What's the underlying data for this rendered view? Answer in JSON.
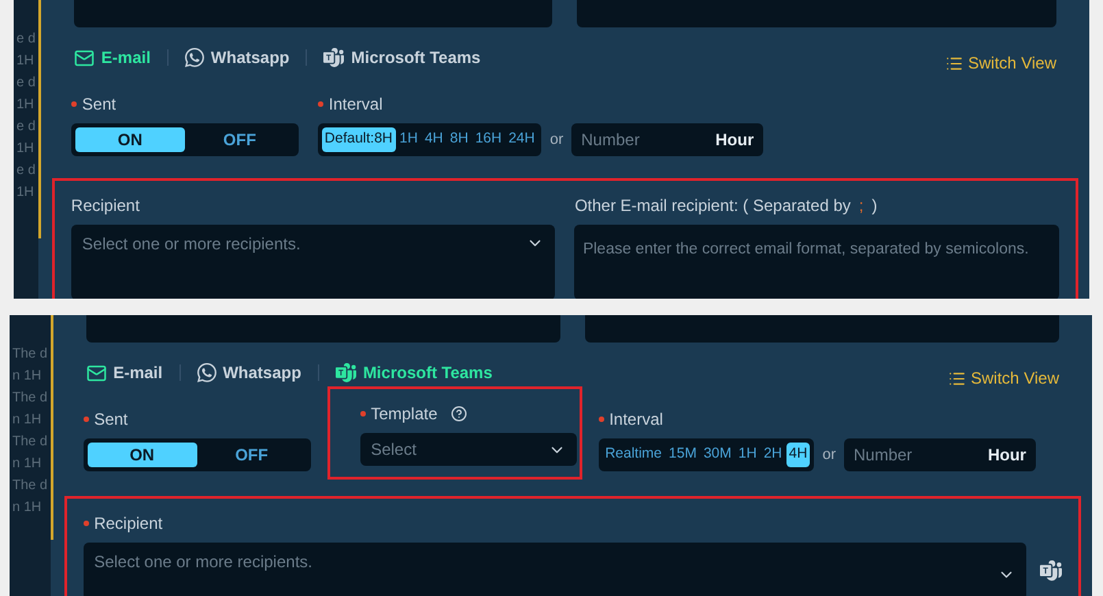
{
  "panels": [
    {
      "side_texts": [
        "e d",
        "1H",
        "e d",
        "1H",
        "e d",
        "1H",
        "e d",
        "1H"
      ],
      "channels": [
        {
          "kind": "email",
          "label": "E-mail",
          "selected": true
        },
        {
          "kind": "whatsapp",
          "label": "Whatsapp",
          "selected": false
        },
        {
          "kind": "teams",
          "label": "Microsoft Teams",
          "selected": false
        }
      ],
      "switch_view": "Switch View",
      "rows": [
        {
          "highlighted": false,
          "fields": [
            {
              "kind": "toggle",
              "label": "Sent",
              "required": true,
              "highlighted": false,
              "options": [
                {
                  "label": "ON",
                  "selected": true
                },
                {
                  "label": "OFF",
                  "selected": false
                }
              ]
            },
            {
              "kind": "interval",
              "label": "Interval",
              "required": true,
              "highlighted": false,
              "options": [
                {
                  "label": "Default:8H",
                  "selected": true
                },
                {
                  "label": "1H",
                  "selected": false
                },
                {
                  "label": "4H",
                  "selected": false
                },
                {
                  "label": "8H",
                  "selected": false
                },
                {
                  "label": "16H",
                  "selected": false
                },
                {
                  "label": "24H",
                  "selected": false
                }
              ],
              "or": "or",
              "placeholder": "Number",
              "unit": "Hour"
            }
          ]
        },
        {
          "highlighted": true,
          "fields": [
            {
              "kind": "multiselect",
              "label": "Recipient",
              "required": false,
              "highlighted": false,
              "placeholder": "Select one or more recipients.",
              "app_icon": false
            },
            {
              "kind": "textarea",
              "label": "Other E-mail recipient: ( Separated by",
              "separator": ";",
              "label_end": ")",
              "required": false,
              "highlighted": false,
              "placeholder": "Please enter the correct email format, separated by semicolons."
            }
          ]
        }
      ]
    },
    {
      "side_texts": [
        "The d",
        "n 1H",
        "The d",
        "n 1H",
        "The d",
        "n 1H",
        "The d",
        "n 1H"
      ],
      "channels": [
        {
          "kind": "email",
          "label": "E-mail",
          "selected": false
        },
        {
          "kind": "whatsapp",
          "label": "Whatsapp",
          "selected": false
        },
        {
          "kind": "teams",
          "label": "Microsoft Teams",
          "selected": true
        }
      ],
      "switch_view": "Switch View",
      "rows": [
        {
          "highlighted": false,
          "fields": [
            {
              "kind": "toggle",
              "label": "Sent",
              "required": true,
              "highlighted": false,
              "options": [
                {
                  "label": "ON",
                  "selected": true
                },
                {
                  "label": "OFF",
                  "selected": false
                }
              ]
            },
            {
              "kind": "select",
              "label": "Template",
              "required": true,
              "highlighted": true,
              "placeholder": "Select"
            },
            {
              "kind": "interval",
              "label": "Interval",
              "required": true,
              "highlighted": false,
              "options": [
                {
                  "label": "Realtime",
                  "selected": false
                },
                {
                  "label": "15M",
                  "selected": false
                },
                {
                  "label": "30M",
                  "selected": false
                },
                {
                  "label": "1H",
                  "selected": false
                },
                {
                  "label": "2H",
                  "selected": false
                },
                {
                  "label": "4H",
                  "selected": true
                }
              ],
              "or": "or",
              "placeholder": "Number",
              "unit": "Hour"
            }
          ]
        },
        {
          "highlighted": true,
          "fields": [
            {
              "kind": "multiselect",
              "label": "Recipient",
              "required": true,
              "highlighted": false,
              "placeholder": "Select one or more recipients.",
              "app_icon": true
            }
          ]
        }
      ]
    }
  ]
}
